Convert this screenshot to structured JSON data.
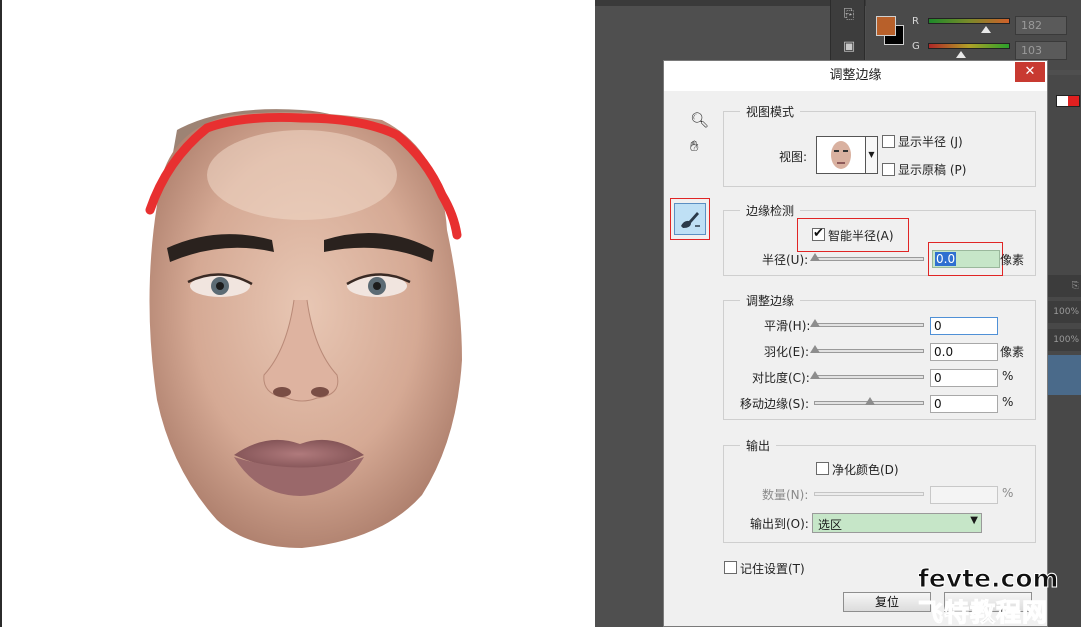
{
  "dialog": {
    "title": "调整边缘",
    "close_symbol": "✕"
  },
  "view_mode": {
    "legend": "视图模式",
    "view_label": "视图:",
    "show_radius": "显示半径 (J)",
    "show_original": "显示原稿 (P)"
  },
  "edge_detection": {
    "legend": "边缘检测",
    "smart_radius": "智能半径(A)",
    "smart_radius_checked": true,
    "radius_label": "半径(U):",
    "radius_value": "0.0",
    "radius_unit": "像素"
  },
  "adjust_edge": {
    "legend": "调整边缘",
    "rows": [
      {
        "label": "平滑(H):",
        "value": "0",
        "unit": "",
        "thumb": 0.0
      },
      {
        "label": "羽化(E):",
        "value": "0.0",
        "unit": "像素",
        "thumb": 0.0
      },
      {
        "label": "对比度(C):",
        "value": "0",
        "unit": "%",
        "thumb": 0.0
      },
      {
        "label": "移动边缘(S):",
        "value": "0",
        "unit": "%",
        "thumb": 0.5
      }
    ]
  },
  "output": {
    "legend": "输出",
    "decontaminate": "净化颜色(D)",
    "amount_label": "数量(N):",
    "amount_unit": "%",
    "output_to_label": "输出到(O):",
    "output_to_value": "选区"
  },
  "remember": "记住设置(T)",
  "buttons": {
    "reset": "复位"
  },
  "color_panel": {
    "fg_color": "#b8602a",
    "bg_color": "#000000",
    "r_label": "R",
    "g_label": "G",
    "r_value": "182",
    "g_value": "103",
    "r_level": 0.71,
    "g_level": 0.4
  },
  "side_panel": {
    "opacity_1": "100%",
    "opacity_2": "100%"
  },
  "watermark": {
    "line1": "fevte.com",
    "line2": "飞特教程网"
  },
  "annotation_color": "#e02525"
}
